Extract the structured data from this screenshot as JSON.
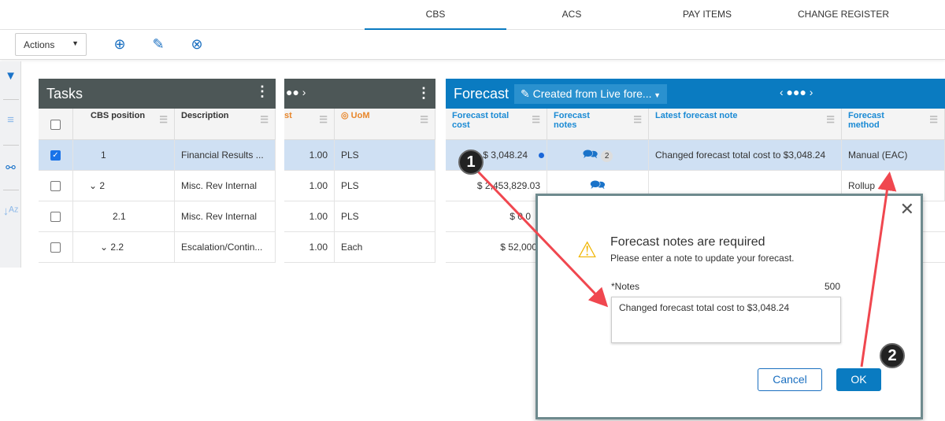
{
  "nav": {
    "tabs": [
      "CBS",
      "ACS",
      "PAY ITEMS",
      "CHANGE REGISTER"
    ],
    "active": "CBS"
  },
  "toolbar": {
    "actions_label": "Actions"
  },
  "tasks": {
    "title": "Tasks",
    "headers": {
      "cbs": "CBS position",
      "description": "Description"
    },
    "rows": [
      {
        "pos": "1",
        "desc": "Financial Results ...",
        "checked": true
      },
      {
        "pos": "2",
        "desc": "Misc. Rev Internal"
      },
      {
        "pos": "2.1",
        "desc": "Misc. Rev Internal"
      },
      {
        "pos": "2.2",
        "desc": "Escalation/Contin..."
      }
    ]
  },
  "mid": {
    "headers": {
      "cost": "st",
      "uom": "UoM"
    },
    "rows": [
      {
        "qty": "1.00",
        "uom": "PLS"
      },
      {
        "qty": "1.00",
        "uom": "PLS"
      },
      {
        "qty": "1.00",
        "uom": "PLS"
      },
      {
        "qty": "1.00",
        "uom": "Each"
      }
    ]
  },
  "forecast": {
    "title": "Forecast",
    "dropdown": "Created from Live fore...",
    "headers": {
      "total": "Forecast total cost",
      "notes": "Forecast notes",
      "latest": "Latest forecast note",
      "method": "Forecast method"
    },
    "rows": [
      {
        "total": "$ 3,048.24",
        "notes_count": "2",
        "latest": "Changed forecast total cost to $3,048.24",
        "method": "Manual (EAC)"
      },
      {
        "total": "$ 2,453,829.03",
        "method": "Rollup"
      },
      {
        "total": "$ 0.0"
      },
      {
        "total": "$ 52,000.0"
      }
    ]
  },
  "dialog": {
    "title": "Forecast notes are required",
    "subtitle": "Please enter a note to update your forecast.",
    "notes_label": "*Notes",
    "char_count": "500",
    "notes_value": "Changed forecast total cost to $3,048.24",
    "cancel": "Cancel",
    "ok": "OK"
  },
  "annotations": {
    "step1": "1",
    "step2": "2"
  },
  "colors": {
    "accent": "#0a7bc1",
    "tasks_header": "#4d5757",
    "highlight": "#cfe0f3",
    "arrow": "#f0474f"
  }
}
